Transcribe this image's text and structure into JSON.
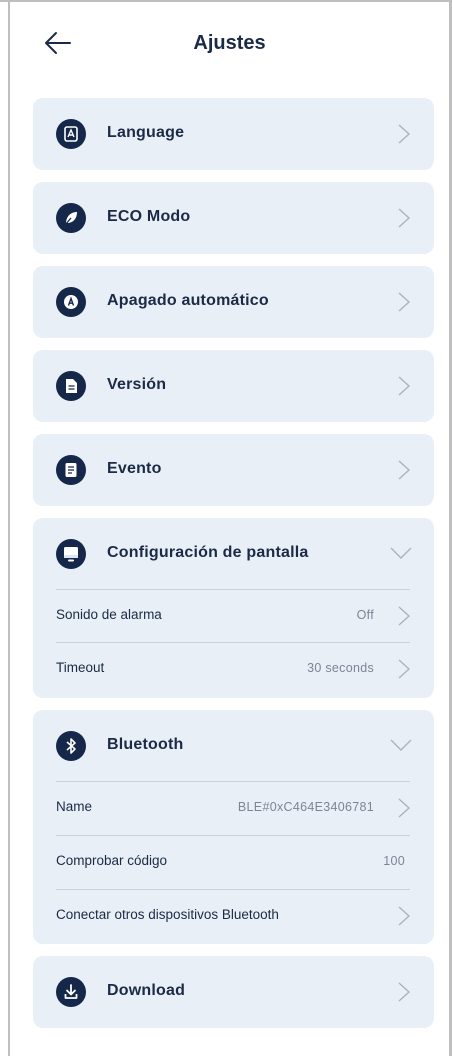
{
  "header": {
    "title": "Ajustes",
    "back_icon": "arrow-left-icon"
  },
  "items": [
    {
      "label": "Language",
      "icon": "language-icon"
    },
    {
      "label": "ECO Modo",
      "icon": "leaf-icon"
    },
    {
      "label": "Apagado automático",
      "icon": "auto-off-icon"
    },
    {
      "label": "Versión",
      "icon": "document-icon"
    },
    {
      "label": "Evento",
      "icon": "event-list-icon"
    }
  ],
  "display_config": {
    "label": "Configuración de pantalla",
    "icon": "monitor-icon",
    "rows": [
      {
        "label": "Sonido de alarma",
        "value": "Off"
      },
      {
        "label": "Timeout",
        "value": "30 seconds"
      }
    ]
  },
  "bluetooth": {
    "label": "Bluetooth",
    "icon": "bluetooth-icon",
    "rows": [
      {
        "label": "Name",
        "value": "BLE#0xC464E3406781"
      },
      {
        "label": "Comprobar código",
        "value": "100"
      },
      {
        "label": "Conectar otros dispositivos Bluetooth",
        "value": ""
      }
    ]
  },
  "download": {
    "label": "Download",
    "icon": "download-icon"
  },
  "colors": {
    "card_bg": "#e8eff7",
    "icon_bg": "#15284a",
    "text": "#1b2a45",
    "muted": "#7b8594"
  }
}
